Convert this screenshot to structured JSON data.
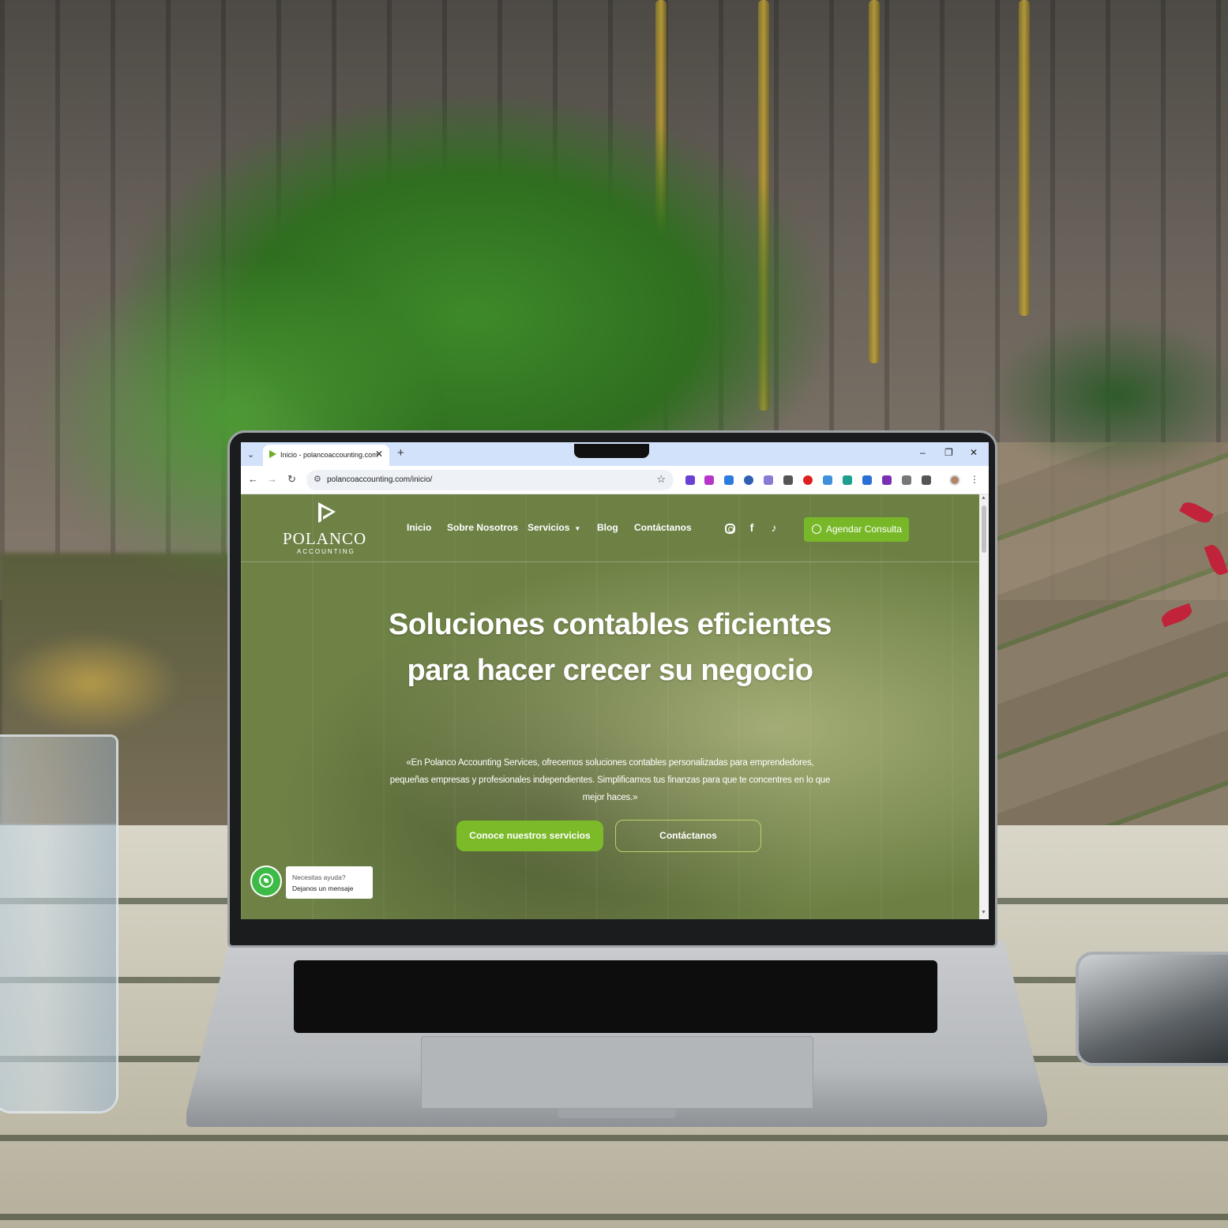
{
  "browser": {
    "tab_title": "Inicio - polancoaccounting.com",
    "tab_close": "✕",
    "new_tab": "+",
    "tab_menu": "⌄",
    "url": "polancoaccounting.com/inicio/",
    "window_controls": [
      "–",
      "❐",
      "✕"
    ],
    "nav_icons": [
      "arrow-left-icon",
      "arrow-right-icon",
      "reload-icon"
    ],
    "extension_colors": [
      "#6a3fd3",
      "#b536c9",
      "#2d7be0",
      "#2f5fb3",
      "#8a7ad6",
      "#555555",
      "#e02020",
      "#3f8fdb",
      "#1e9e8e",
      "#2a6fd6",
      "#7b2fb5",
      "#777777",
      "#555555"
    ]
  },
  "site": {
    "logo": {
      "name": "POLANCO",
      "sub": "ACCOUNTING"
    },
    "nav": [
      {
        "label": "Inicio"
      },
      {
        "label": "Sobre Nosotros"
      },
      {
        "label": "Servicios",
        "has_dropdown": true
      },
      {
        "label": "Blog"
      },
      {
        "label": "Contáctanos"
      }
    ],
    "social": [
      "instagram-icon",
      "facebook-icon",
      "tiktok-icon"
    ],
    "cta_label": "Agendar Consulta",
    "hero": {
      "title": "Soluciones contables eficientes para hacer crecer su negocio",
      "text": "«En Polanco Accounting Services, ofrecemos soluciones contables personalizadas para emprendedores, pequeñas empresas y profesionales independientes. Simplificamos tus finanzas para que te concentres en lo que mejor haces.»",
      "primary_button": "Conoce nuestros servicios",
      "secondary_button": "Contáctanos"
    },
    "whatsapp": {
      "line1": "Necesitas ayuda?",
      "line2": "Dejanos un mensaje"
    }
  },
  "colors": {
    "brand_green": "#78b828",
    "overlay_green": "#6c8044",
    "chrome_tab_strip": "#d3e2fb"
  }
}
